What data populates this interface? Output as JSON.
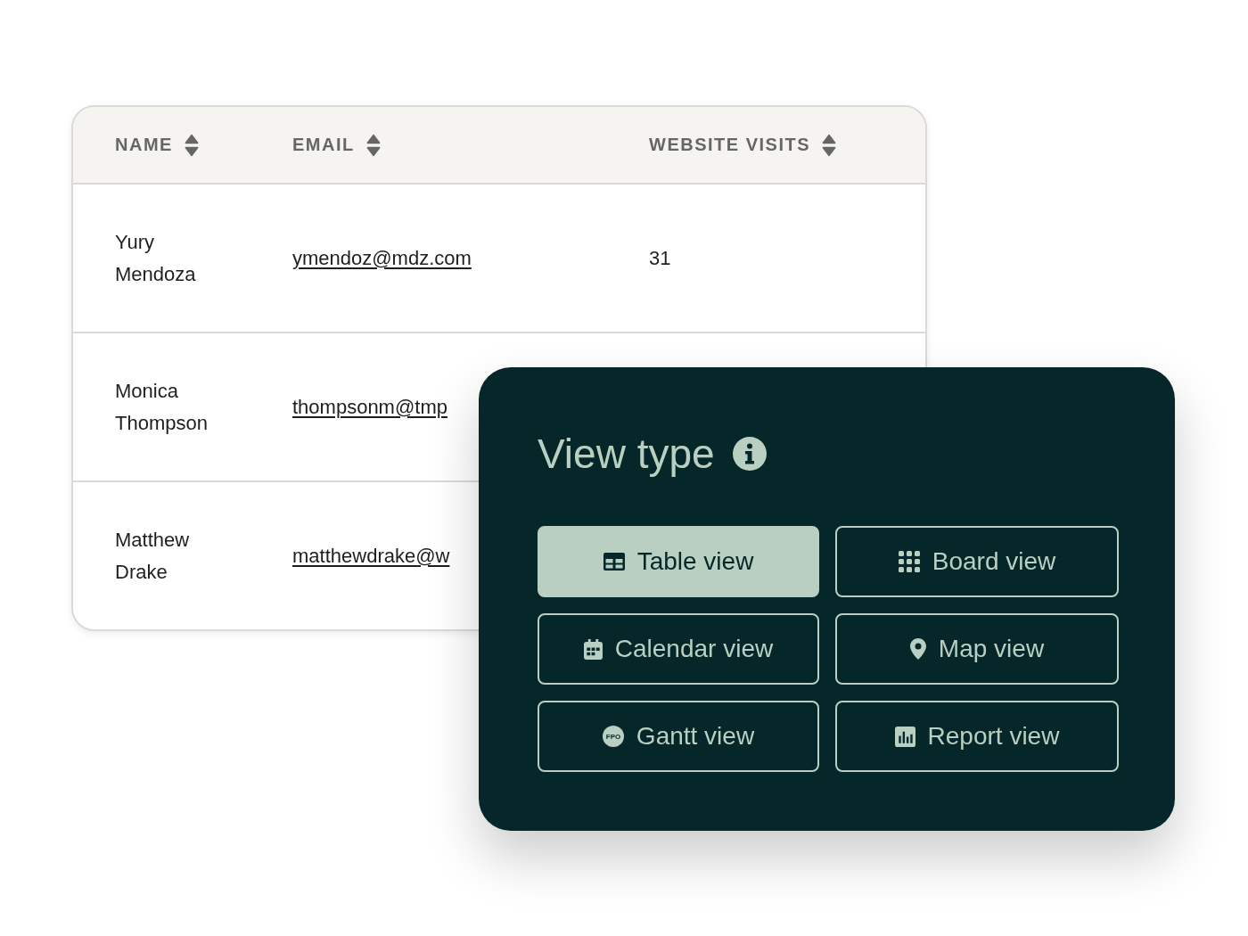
{
  "table": {
    "columns": [
      "NAME",
      "EMAIL",
      "WEBSITE VISITS"
    ],
    "rows": [
      {
        "name": "Yury Mendoza",
        "email": "ymendoz@mdz.com",
        "website_visits": "31"
      },
      {
        "name": "Monica Thompson",
        "email": "thompsonm@tmp"
      },
      {
        "name": "Matthew Drake",
        "email": "matthewdrake@w"
      }
    ]
  },
  "view_type_panel": {
    "title": "View type",
    "options": [
      {
        "label": "Table view",
        "selected": true
      },
      {
        "label": "Board view",
        "selected": false
      },
      {
        "label": "Calendar view",
        "selected": false
      },
      {
        "label": "Map view",
        "selected": false
      },
      {
        "label": "Gantt view",
        "selected": false,
        "icon_text": "FPO"
      },
      {
        "label": "Report view",
        "selected": false
      }
    ]
  }
}
